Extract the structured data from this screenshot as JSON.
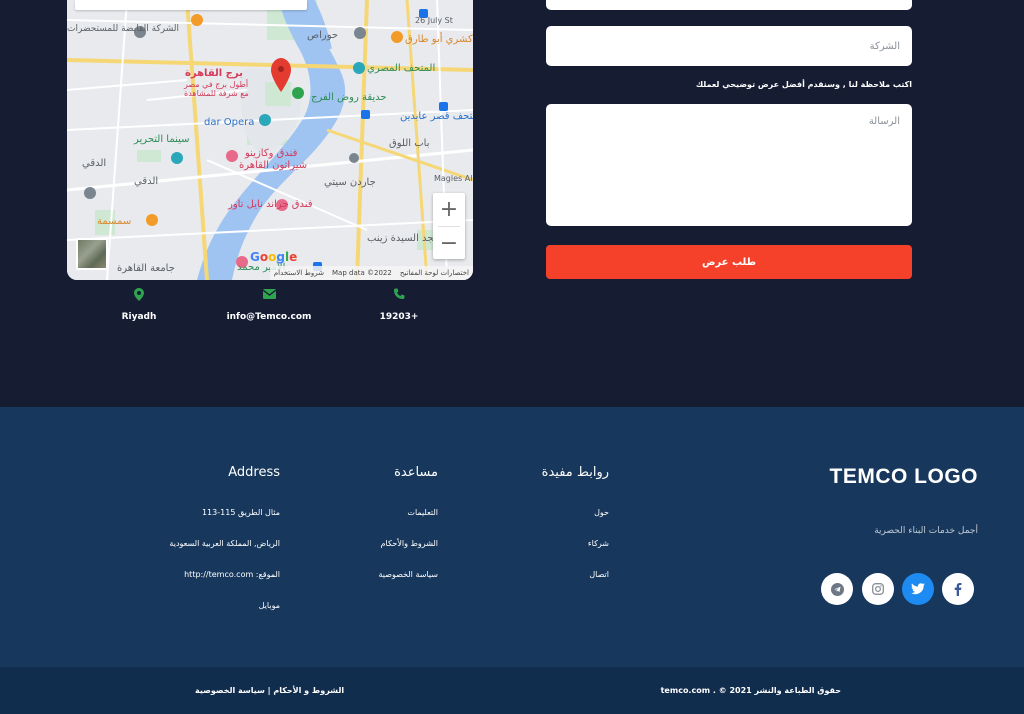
{
  "map": {
    "labels": {
      "cairo_tower": "برج القاهرة",
      "cairo_tower_sub1": "أطول برج في مصر",
      "cairo_tower_sub2": "مع شرفة للمشاهدة",
      "opera": "dar Opera",
      "tahrir_cinema": "سينما التحرير",
      "dokki_top": "الدقي",
      "dokki_mid": "الدقي",
      "hotel1": "فندق وكازينو",
      "hotel1_b": "شيراتون القاهرة",
      "hotel2": "فندق جراند نايل تاور",
      "egyptian_museum": "المتحف المصري",
      "abdeen_museum": "متحف قصر عابدين",
      "bab_elouq": "باب اللوق",
      "garden_city": "جاردن سيتي",
      "sayeda": "مسجد السيدة زينب",
      "roda_garden": "حديقة روض الفرج",
      "garden_city_left": "الشركة القابضة للمستحضرات",
      "abou_tarek": "كشري أبو طارق",
      "samsema": "سمسمة",
      "qasr": "جامعة القاهرة",
      "magles": "Magles Al",
      "street_26july": "26 July St",
      "amir": "الأمير محمد",
      "hozan": "حوراص"
    },
    "google": [
      "G",
      "o",
      "o",
      "g",
      "l",
      "e"
    ],
    "attribution": {
      "shortcuts": "اختصارات لوحة المفاتيح",
      "data": "Map data ©2022",
      "terms": "شروط الاستخدام"
    },
    "zoom_in": "+",
    "zoom_out": "−"
  },
  "contacts": [
    {
      "icon": "map-pin-icon",
      "text": "Riyadh"
    },
    {
      "icon": "envelope-icon",
      "text": "info@Temco.com"
    },
    {
      "icon": "phone-icon",
      "text": "19203+"
    }
  ],
  "form": {
    "company_placeholder": "الشركة",
    "note": "اكتب ملاحظة لنا , وسنقدم أفضل عرض توضيحي لعملك",
    "message_placeholder": "الرسالة",
    "submit_label": "طلب عرض"
  },
  "footer": {
    "brand": "TEMCO LOGO",
    "tagline": "أجمل خدمات البناء الحصرية",
    "social": [
      {
        "name": "facebook-icon",
        "color": "#3b5998"
      },
      {
        "name": "twitter-icon",
        "color": "#ffffff"
      },
      {
        "name": "instagram-icon",
        "color": "#8a8f98"
      },
      {
        "name": "telegram-icon",
        "color": "#6e7784"
      }
    ],
    "useful_links": {
      "title": "روابط مفيدة",
      "items": [
        "حول",
        "شركاء",
        "اتصال"
      ]
    },
    "help": {
      "title": "مساعدة",
      "items": [
        "التعليمات",
        "الشروط والأحكام",
        "سياسة الخصوصية"
      ]
    },
    "address": {
      "title": "Address",
      "items": [
        "مثال الطريق 115-113",
        "الرياض, المملكة العربية السعودية",
        "الموقع: http://temco.com",
        "موبايل"
      ]
    },
    "copyright": "حقوق الطباعة والنشر 2021 © . temco.com",
    "legal": "الشروط و الأحكام | سياسة الخصوصية"
  }
}
